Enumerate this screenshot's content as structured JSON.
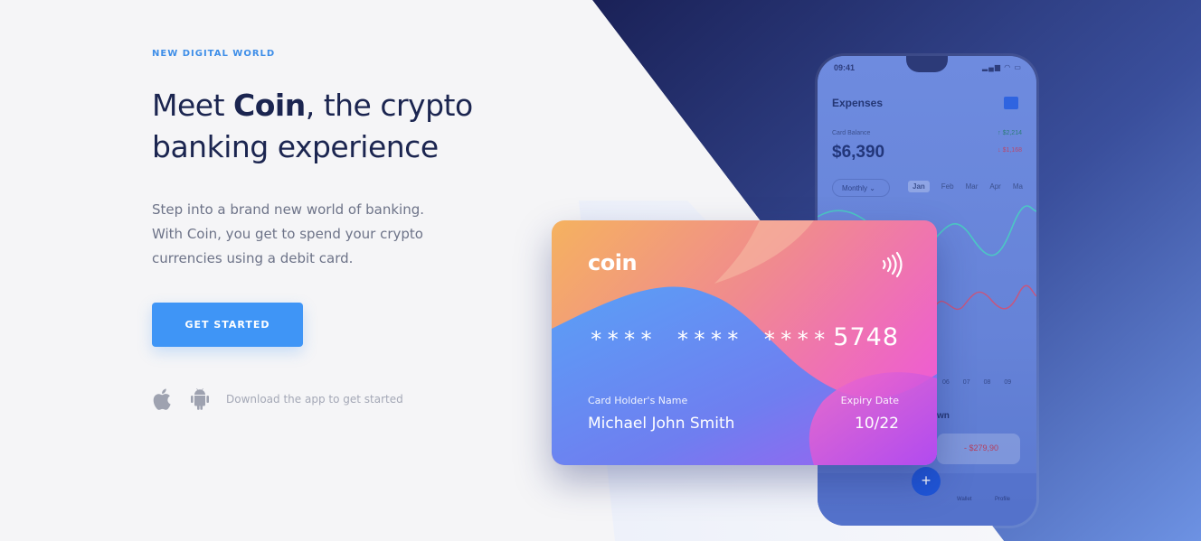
{
  "hero": {
    "eyebrow": "NEW DIGITAL WORLD",
    "headline_prefix": "Meet ",
    "headline_brand": "Coin",
    "headline_suffix": ", the crypto banking experience",
    "description_lines": [
      "Step into a brand new world of banking.",
      "With Coin, you get to spend your crypto",
      "currencies using a debit card."
    ],
    "cta_label": "GET STARTED",
    "download_text": "Download the app to get started",
    "store_icons": [
      "apple-icon",
      "android-icon"
    ]
  },
  "colors": {
    "accent": "#3f95f6",
    "headline": "#1b2550",
    "panel_dark": "#1c2459",
    "panel_light": "#6a8ee0"
  },
  "phone": {
    "time": "09:41",
    "title": "Expenses",
    "balance_label": "Card Balance",
    "balance": "$6,390",
    "income": "$2,214",
    "expense": "$1,168",
    "filter": "Monthly",
    "months": [
      "Jan",
      "Feb",
      "Mar",
      "Apr",
      "Ma"
    ],
    "days": [
      "06",
      "07",
      "08",
      "09"
    ],
    "section_partial": "wn",
    "amount": "- $279,90",
    "nav_labels": [
      "Wallet",
      "Profile"
    ]
  },
  "card": {
    "brand": "coin",
    "masked_groups": [
      "****",
      "****",
      "****"
    ],
    "last4": "5748",
    "holder_label": "Card Holder's Name",
    "holder_name": "Michael John Smith",
    "expiry_label": "Expiry Date",
    "expiry": "10/22"
  }
}
